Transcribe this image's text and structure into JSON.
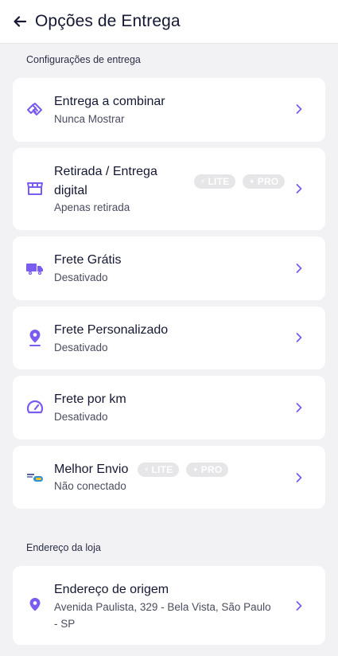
{
  "header": {
    "title": "Opções de Entrega"
  },
  "sections": {
    "delivery_settings": "Configurações de entrega",
    "store_address": "Endereço da loja"
  },
  "badges": {
    "lite": "LITE",
    "pro": "PRO"
  },
  "items": [
    {
      "title": "Entrega a combinar",
      "subtitle": "Nunca Mostrar",
      "icon": "handshake-icon"
    },
    {
      "title_line1": "Retirada / Entrega",
      "title_line2": "digital",
      "subtitle": "Apenas retirada",
      "icon": "store-icon"
    },
    {
      "title": "Frete Grátis",
      "subtitle": "Desativado",
      "icon": "truck-icon"
    },
    {
      "title": "Frete Personalizado",
      "subtitle": "Desativado",
      "icon": "location-pin-icon"
    },
    {
      "title": "Frete por km",
      "subtitle": "Desativado",
      "icon": "speedometer-icon"
    },
    {
      "title": "Melhor Envio",
      "subtitle": "Não conectado",
      "icon": "melhor-envio-logo"
    }
  ],
  "address": {
    "title": "Endereço de origem",
    "line1": "Avenida Paulista, 329 - Bela Vista, São Paulo",
    "line2": "- SP",
    "icon": "location-pin-icon"
  },
  "colors": {
    "accent": "#7b5cf0",
    "badge_bg": "#e6e6e9",
    "background": "#f2f2f5"
  }
}
